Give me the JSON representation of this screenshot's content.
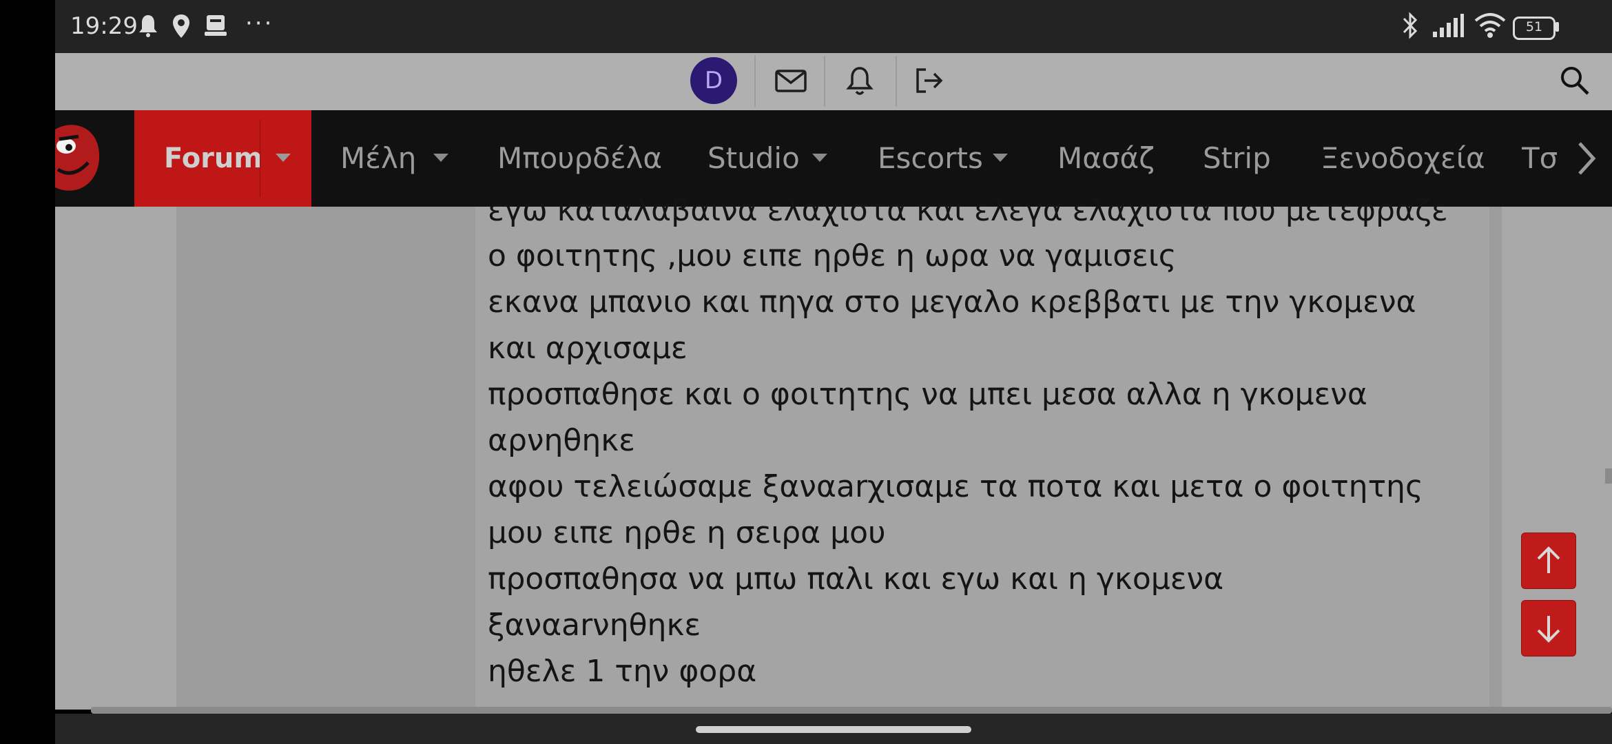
{
  "status_bar": {
    "time": "19:29",
    "battery": "51"
  },
  "header": {
    "avatar_letter": "D"
  },
  "nav": {
    "items": [
      {
        "label": "Forum"
      },
      {
        "label": "Μέλη"
      },
      {
        "label": "Μπουρδέλα"
      },
      {
        "label": "Studio"
      },
      {
        "label": "Escorts"
      },
      {
        "label": "Μασάζ"
      },
      {
        "label": "Strip"
      },
      {
        "label": "Ξενοδοχεία"
      },
      {
        "label": "Τσ"
      }
    ]
  },
  "post": {
    "lines": [
      "εγω καταλαβαινα ελαχιστα και ελεγα ελαχιστα που μετεφραζε",
      "ο φοιτητης ,μου ειπε ηρθε η ωρα να γαμισεις",
      "εκανα μπανιο και πηγα στο μεγαλο κρεββατι με την γκομενα",
      "και αρχισαμε",
      "προσπαθησε και ο φοιτητης να μπει μεσα αλλα η γκομενα",
      "αρνηθηκε",
      "αφου τελειώσαμε ξαναarχισαμε τα ποτα και μετα ο φοιτητης",
      "μου ειπε ηρθε η σειρα μου",
      "προσπαθησα να μπω παλι και εγω και η γκομενα",
      "ξαναarνηθηκε",
      "ηθελε 1 την φορα"
    ]
  },
  "colors": {
    "accent": "#bf1616",
    "nav_bg": "#111111",
    "avatar_bg": "#2c1a72"
  }
}
